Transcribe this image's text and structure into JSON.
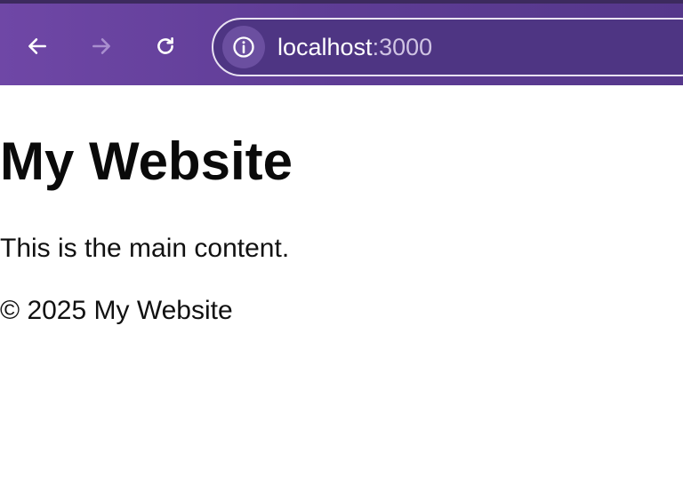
{
  "browser": {
    "url_host": "localhost",
    "url_port": ":3000",
    "back_icon": "arrow-left-icon",
    "forward_icon": "arrow-right-icon",
    "reload_icon": "reload-icon",
    "site_info_icon": "info-icon",
    "colors": {
      "toolbar": "#6f47a6",
      "omnibox": "#4e3583",
      "forward_disabled": "#a98fcf"
    }
  },
  "page": {
    "heading": "My Website",
    "main_content": "This is the main content.",
    "footer": "© 2025 My Website"
  }
}
